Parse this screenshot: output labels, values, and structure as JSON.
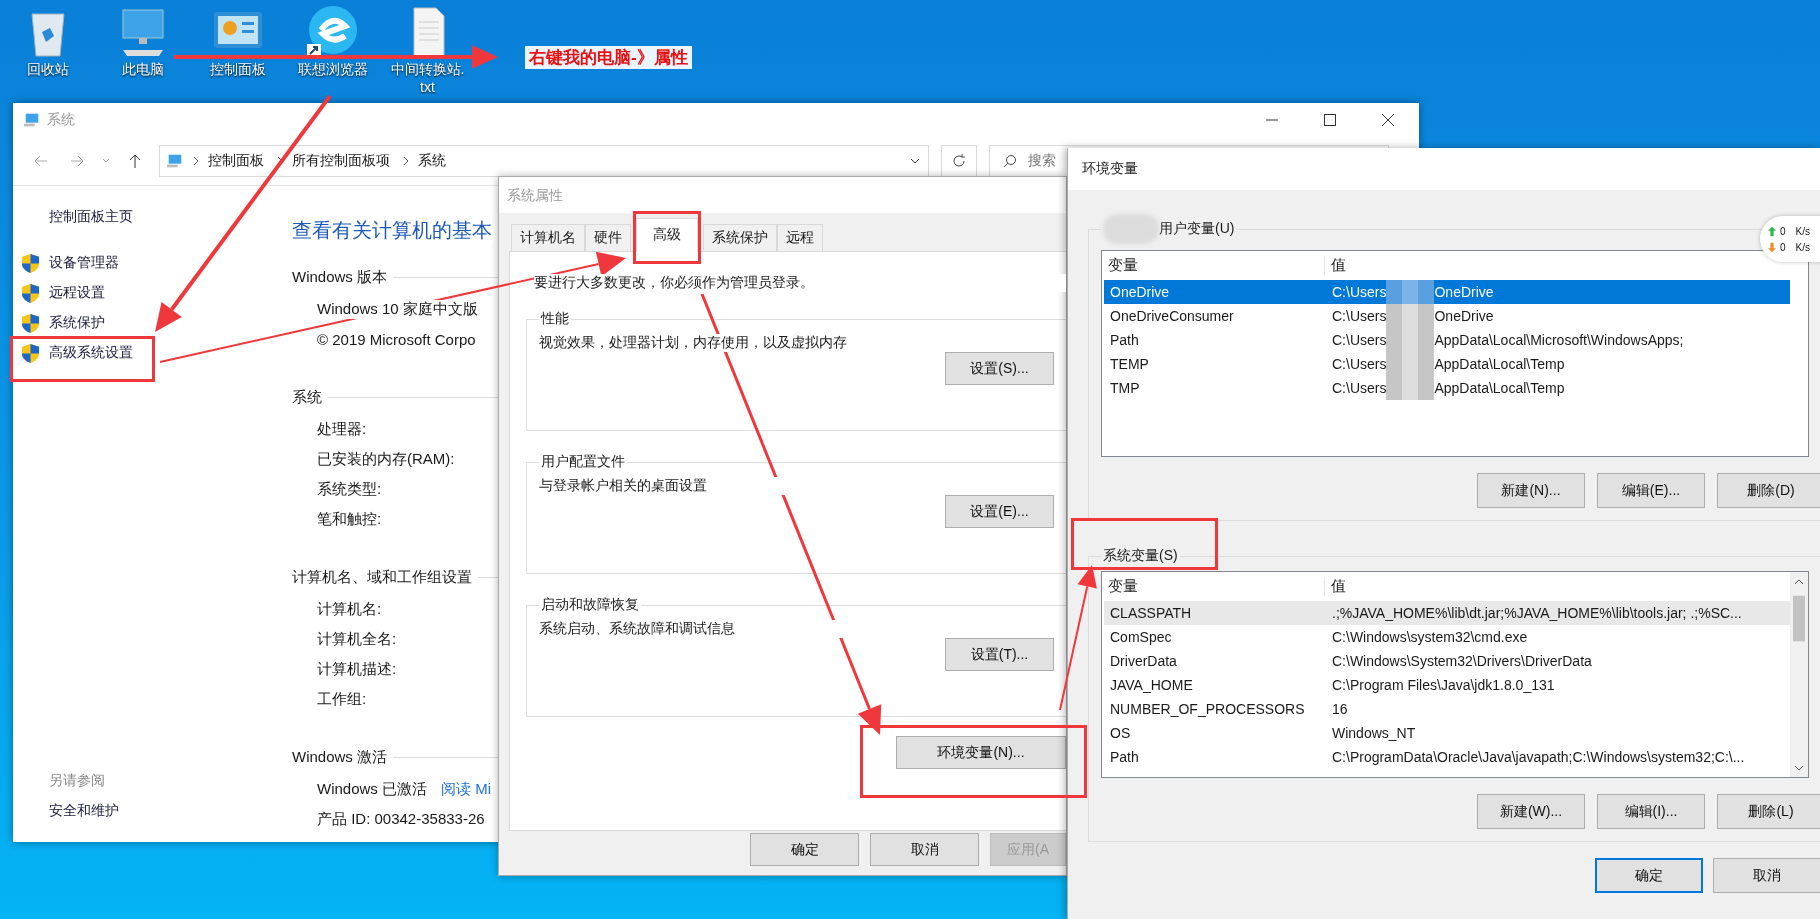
{
  "desktop": {
    "icons": [
      {
        "label": "回收站",
        "kind": "recycle",
        "shortcut": false
      },
      {
        "label": "此电脑",
        "kind": "computer",
        "shortcut": false
      },
      {
        "label": "控制面板",
        "kind": "panel",
        "shortcut": false
      },
      {
        "label": "联想浏览器",
        "kind": "browser",
        "shortcut": true
      },
      {
        "label": "中间转换站.txt",
        "kind": "textfile",
        "shortcut": false
      }
    ],
    "note": "右键我的电脑-》属性"
  },
  "system_window": {
    "title": "系统",
    "breadcrumb": [
      "控制面板",
      "所有控制面板项",
      "系统"
    ],
    "search_placeholder": "搜索",
    "nav": [
      {
        "label": "控制面板主页",
        "shield": false
      },
      {
        "label": "设备管理器",
        "shield": true
      },
      {
        "label": "远程设置",
        "shield": true
      },
      {
        "label": "系统保护",
        "shield": true
      },
      {
        "label": "高级系统设置",
        "shield": true
      }
    ],
    "see_also_title": "另请参阅",
    "see_also": [
      "安全和维护"
    ],
    "heading": "查看有关计算机的基本",
    "sections": [
      {
        "title": "Windows 版本",
        "rows": [
          {
            "text": "Windows 10 家庭中文版"
          },
          {
            "text": "© 2019 Microsoft Corpo"
          }
        ]
      },
      {
        "title": "系统",
        "rows": [
          {
            "text": "处理器:"
          },
          {
            "text": "已安装的内存(RAM):"
          },
          {
            "text": "系统类型:"
          },
          {
            "text": "笔和触控:"
          }
        ]
      },
      {
        "title": "计算机名、域和工作组设置",
        "rows": [
          {
            "text": "计算机名:"
          },
          {
            "text": "计算机全名:"
          },
          {
            "text": "计算机描述:"
          },
          {
            "text": "工作组:"
          }
        ]
      },
      {
        "title": "Windows 激活",
        "rows": [
          {
            "text": "Windows 已激活",
            "link": "阅读 Mi"
          },
          {
            "text": "产品 ID: 00342-35833-26"
          }
        ]
      }
    ]
  },
  "system_properties": {
    "title": "系统属性",
    "tabs": [
      {
        "label": "计算机名",
        "selected": false
      },
      {
        "label": "硬件",
        "selected": false
      },
      {
        "label": "高级",
        "selected": true
      },
      {
        "label": "系统保护",
        "selected": false
      },
      {
        "label": "远程",
        "selected": false
      }
    ],
    "notice": "要进行大多数更改，你必须作为管理员登录。",
    "groups": [
      {
        "title": "性能",
        "description": "视觉效果，处理器计划，内存使用，以及虚拟内存",
        "button": "设置(S)..."
      },
      {
        "title": "用户配置文件",
        "description": "与登录帐户相关的桌面设置",
        "button": "设置(E)..."
      },
      {
        "title": "启动和故障恢复",
        "description": "系统启动、系统故障和调试信息",
        "button": "设置(T)..."
      }
    ],
    "env_button": "环境变量(N)...",
    "buttons": [
      {
        "label": "确定",
        "disabled": false
      },
      {
        "label": "取消",
        "disabled": false
      },
      {
        "label": "应用(A",
        "disabled": true
      }
    ]
  },
  "environment_variables": {
    "title": "环境变量",
    "user": {
      "title": "用户变量(U)",
      "focused": true,
      "columns": [
        "变量",
        "值"
      ],
      "rows": [
        {
          "name": "OneDrive",
          "value_start": "C:\\Users",
          "value_end": "OneDrive",
          "selected": true
        },
        {
          "name": "OneDriveConsumer",
          "value_start": "C:\\Users",
          "value_end": "OneDrive",
          "selected": false
        },
        {
          "name": "Path",
          "value_start": "C:\\Users",
          "value_end": "AppData\\Local\\Microsoft\\WindowsApps;",
          "selected": false
        },
        {
          "name": "TEMP",
          "value_start": "C:\\Users",
          "value_end": "AppData\\Local\\Temp",
          "selected": false
        },
        {
          "name": "TMP",
          "value_start": "C:\\Users",
          "value_end": "AppData\\Local\\Temp",
          "selected": false
        }
      ],
      "buttons": [
        "新建(N)...",
        "编辑(E)...",
        "删除(D)"
      ]
    },
    "system": {
      "title": "系统变量(S)",
      "focused": false,
      "columns": [
        "变量",
        "值"
      ],
      "rows": [
        {
          "name": "CLASSPATH",
          "value": ".;%JAVA_HOME%\\lib\\dt.jar;%JAVA_HOME%\\lib\\tools.jar;  .;%SC...",
          "selected": true
        },
        {
          "name": "ComSpec",
          "value": "C:\\Windows\\system32\\cmd.exe",
          "selected": false
        },
        {
          "name": "DriverData",
          "value": "C:\\Windows\\System32\\Drivers\\DriverData",
          "selected": false
        },
        {
          "name": "JAVA_HOME",
          "value": "C:\\Program Files\\Java\\jdk1.8.0_131",
          "selected": false
        },
        {
          "name": "NUMBER_OF_PROCESSORS",
          "value": "16",
          "selected": false
        },
        {
          "name": "OS",
          "value": "Windows_NT",
          "selected": false
        },
        {
          "name": "Path",
          "value": "C:\\ProgramData\\Oracle\\Java\\javapath;C:\\Windows\\system32;C:\\...",
          "selected": false
        }
      ],
      "buttons": [
        "新建(W)...",
        "编辑(I)...",
        "删除(L)"
      ]
    },
    "buttons": [
      {
        "label": "确定",
        "default": true
      },
      {
        "label": "取消",
        "default": false
      }
    ]
  },
  "net_speed": [
    {
      "value": "0",
      "unit": "K/s",
      "color": "#2fb84a"
    },
    {
      "value": "0",
      "unit": "K/s",
      "color": "#f08a24"
    }
  ]
}
